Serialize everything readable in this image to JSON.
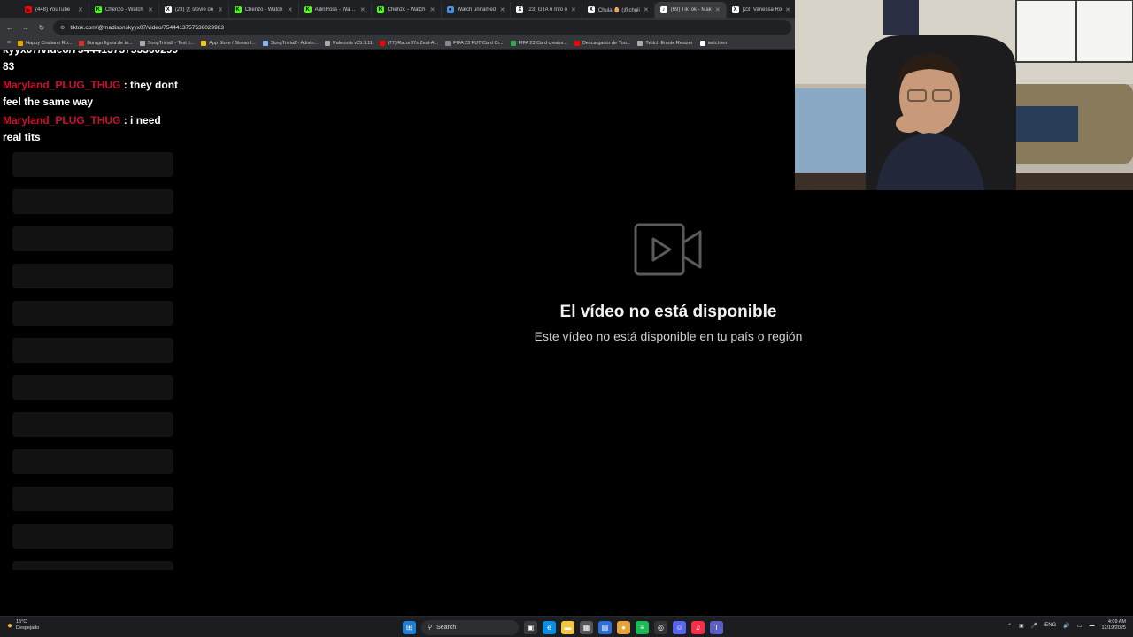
{
  "browser": {
    "tabs": [
      {
        "label": "(448) YouTube",
        "favicon_color": "#ff0000",
        "favicon_glyph": "▶",
        "active": false
      },
      {
        "label": "Chenzo - Watch",
        "favicon_color": "#53fc18",
        "favicon_glyph": "K",
        "active": false
      },
      {
        "label": "(23) 🇦 stevie on",
        "favicon_color": "#ffffff",
        "favicon_glyph": "X",
        "active": false
      },
      {
        "label": "Chenzo - Watch",
        "favicon_color": "#53fc18",
        "favicon_glyph": "K",
        "active": false
      },
      {
        "label": "AdinRoss - Watch",
        "favicon_color": "#53fc18",
        "favicon_glyph": "K",
        "active": false
      },
      {
        "label": "Chenzo - Watch",
        "favicon_color": "#53fc18",
        "favicon_glyph": "K",
        "active": false
      },
      {
        "label": "Watch unnamed",
        "favicon_color": "#4a90e2",
        "favicon_glyph": "●",
        "active": false
      },
      {
        "label": "(23) GTA 6 Info o",
        "favicon_color": "#ffffff",
        "favicon_glyph": "X",
        "active": false
      },
      {
        "label": "Chula 🥚 (@chuli",
        "favicon_color": "#ffffff",
        "favicon_glyph": "X",
        "active": false
      },
      {
        "label": "(69) TikTok - Mak",
        "favicon_color": "#ffffff",
        "favicon_glyph": "♪",
        "active": true
      },
      {
        "label": "(23) Vanessa Ro",
        "favicon_color": "#ffffff",
        "favicon_glyph": "X",
        "active": false
      }
    ],
    "url": "tiktok.com/@madisonskyyx07/video/7544413757536029983",
    "bookmarks": [
      {
        "label": "Happy Cristiano Ro...",
        "color": "#e0a800"
      },
      {
        "label": "Burago figura de to...",
        "color": "#d93025"
      },
      {
        "label": "SongTrivia2 - Test y...",
        "color": "#aaaaaa"
      },
      {
        "label": "App Store / Streaml...",
        "color": "#f5c518"
      },
      {
        "label": "SongTrivia2 - Adivin...",
        "color": "#8ab4f8"
      },
      {
        "label": "Paletools v25.1.11",
        "color": "#aaaaaa"
      },
      {
        "label": "(77) Razor97s Zest-A...",
        "color": "#ff0000"
      },
      {
        "label": "FIFA 23 PUT Card Cr...",
        "color": "#888888"
      },
      {
        "label": "FIFA 23 Card creator...",
        "color": "#34a853"
      },
      {
        "label": "Descargador de You...",
        "color": "#ff0000"
      },
      {
        "label": "Twitch Emote Resizer",
        "color": "#aaaaaa"
      },
      {
        "label": "twitch em",
        "color": "#ffffff"
      }
    ]
  },
  "chat": {
    "partial_line_1": "kyyx07/video/754441375753360299",
    "partial_line_2": "83",
    "messages": [
      {
        "user": "Maryland_PLUG_THUG",
        "text": ": they dont feel the same way"
      },
      {
        "user": "Maryland_PLUG_THUG",
        "text": ": i need real tits"
      }
    ]
  },
  "video": {
    "title": "El vídeo no está disponible",
    "subtitle": "Este vídeo no está disponible en tu país o región",
    "icon": "video-camera-play-icon"
  },
  "taskbar": {
    "weather_temp": "15°C",
    "weather_desc": "Despejado",
    "search_label": "Search",
    "lang": "ENG",
    "time": "4:09 AM",
    "date": "12/19/2025",
    "pinned_apps": [
      {
        "name": "task-view-icon",
        "color": "#3a3a3d",
        "glyph": "▣"
      },
      {
        "name": "edge-icon",
        "color": "#0c8ee0",
        "glyph": "e"
      },
      {
        "name": "file-explorer-icon",
        "color": "#f5c542",
        "glyph": "▬"
      },
      {
        "name": "calculator-icon",
        "color": "#555555",
        "glyph": "▦"
      },
      {
        "name": "store-icon",
        "color": "#2b6fd6",
        "glyph": "▤"
      },
      {
        "name": "chrome-icon",
        "color": "#e8a33b",
        "glyph": "●"
      },
      {
        "name": "spotify-icon",
        "color": "#1db954",
        "glyph": "≡"
      },
      {
        "name": "obs-icon",
        "color": "#333333",
        "glyph": "◎"
      },
      {
        "name": "discord-icon",
        "color": "#5865f2",
        "glyph": "☺"
      },
      {
        "name": "music-icon",
        "color": "#fa2d48",
        "glyph": "♫"
      },
      {
        "name": "teams-icon",
        "color": "#5b5fc7",
        "glyph": "T"
      }
    ]
  }
}
